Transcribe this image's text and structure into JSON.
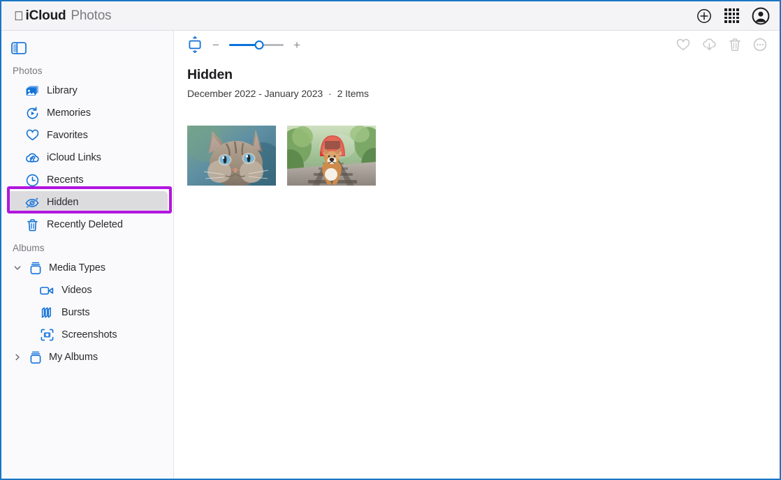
{
  "header": {
    "apple_logo": "apple-logo",
    "brand_primary": "iCloud",
    "brand_secondary": "Photos",
    "actions": [
      {
        "name": "add-button",
        "icon": "plus-circle-icon"
      },
      {
        "name": "app-launcher-button",
        "icon": "grid-dots-icon"
      },
      {
        "name": "account-button",
        "icon": "account-avatar-icon"
      }
    ]
  },
  "sidebar": {
    "toggle_icon": "sidebar-toggle-icon",
    "sections": [
      {
        "label": "Photos",
        "items": [
          {
            "label": "Library",
            "icon": "photo-stack-icon",
            "selected": false
          },
          {
            "label": "Memories",
            "icon": "memories-icon",
            "selected": false
          },
          {
            "label": "Favorites",
            "icon": "heart-icon",
            "selected": false
          },
          {
            "label": "iCloud Links",
            "icon": "cloud-link-icon",
            "selected": false
          },
          {
            "label": "Recents",
            "icon": "clock-icon",
            "selected": false
          },
          {
            "label": "Hidden",
            "icon": "eye-slash-icon",
            "selected": true
          },
          {
            "label": "Recently Deleted",
            "icon": "trash-icon",
            "selected": false
          }
        ]
      },
      {
        "label": "Albums",
        "items": [
          {
            "label": "Media Types",
            "icon": "album-box-icon",
            "chevron": "chevron-down",
            "expanded": true,
            "child": false
          },
          {
            "label": "Videos",
            "icon": "video-icon",
            "child": true
          },
          {
            "label": "Bursts",
            "icon": "bursts-icon",
            "child": true
          },
          {
            "label": "Screenshots",
            "icon": "screenshot-icon",
            "child": true
          },
          {
            "label": "My Albums",
            "icon": "album-box-icon",
            "chevron": "chevron-right",
            "expanded": false,
            "child": false
          }
        ]
      }
    ],
    "annotation": {
      "name": "highlight-box-hidden",
      "color": "#b315e0"
    }
  },
  "toolbar": {
    "resize_icon": "aspect-resize-icon",
    "zoom_out_label": "−",
    "zoom_in_label": "+",
    "zoom_value": 55,
    "right_actions": [
      {
        "name": "favorite-button",
        "icon": "heart-outline-icon"
      },
      {
        "name": "download-button",
        "icon": "cloud-download-icon"
      },
      {
        "name": "delete-button",
        "icon": "trash-outline-icon"
      },
      {
        "name": "more-button",
        "icon": "more-circle-icon"
      }
    ]
  },
  "content": {
    "title": "Hidden",
    "date_range": "December 2022 - January 2023",
    "separator": "·",
    "item_count": "2 Items",
    "photos": [
      {
        "name": "photo-thumbnail-cat",
        "alt": "tabby cat with blue eyes"
      },
      {
        "name": "photo-thumbnail-dog",
        "alt": "corgi dog on railway tracks with red train"
      }
    ]
  },
  "colors": {
    "accent": "#0a72dd",
    "highlight": "#b315e0",
    "window_border": "#1a76c4",
    "selected_row": "#dcdcdf"
  }
}
